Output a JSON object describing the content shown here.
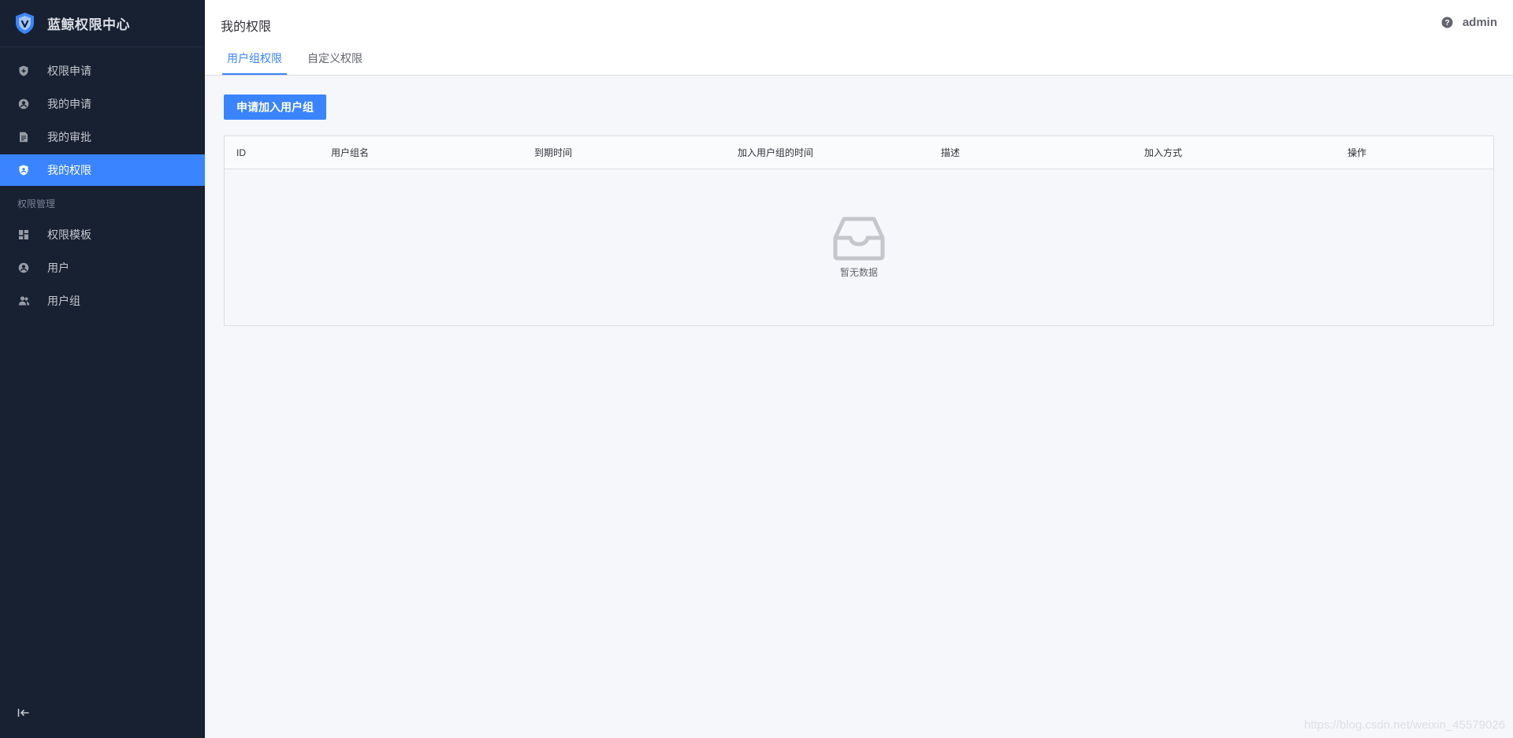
{
  "brand": {
    "title": "蓝鲸权限中心",
    "logo_icon": "shield-logo-icon"
  },
  "sidebar": {
    "items": [
      {
        "label": "权限申请",
        "icon": "shield-plus-icon",
        "active": false
      },
      {
        "label": "我的申请",
        "icon": "user-circle-icon",
        "active": false
      },
      {
        "label": "我的审批",
        "icon": "document-icon",
        "active": false
      },
      {
        "label": "我的权限",
        "icon": "shield-user-icon",
        "active": true
      }
    ],
    "group_title": "权限管理",
    "group_items": [
      {
        "label": "权限模板",
        "icon": "grid-icon"
      },
      {
        "label": "用户",
        "icon": "user-circle-icon"
      },
      {
        "label": "用户组",
        "icon": "users-icon"
      }
    ]
  },
  "header": {
    "title": "我的权限",
    "user": "admin",
    "tabs": [
      {
        "label": "用户组权限",
        "active": true
      },
      {
        "label": "自定义权限",
        "active": false
      }
    ]
  },
  "main": {
    "apply_button": "申请加入用户组",
    "table": {
      "columns": [
        "ID",
        "用户组名",
        "到期时间",
        "加入用户组的时间",
        "描述",
        "加入方式",
        "操作"
      ],
      "rows": [],
      "empty_text": "暂无数据"
    }
  },
  "watermark": "https://blog.csdn.net/weixin_45579026",
  "colors": {
    "sidebar_bg": "#182132",
    "accent": "#3a84ff",
    "content_bg": "#f5f7fa"
  }
}
